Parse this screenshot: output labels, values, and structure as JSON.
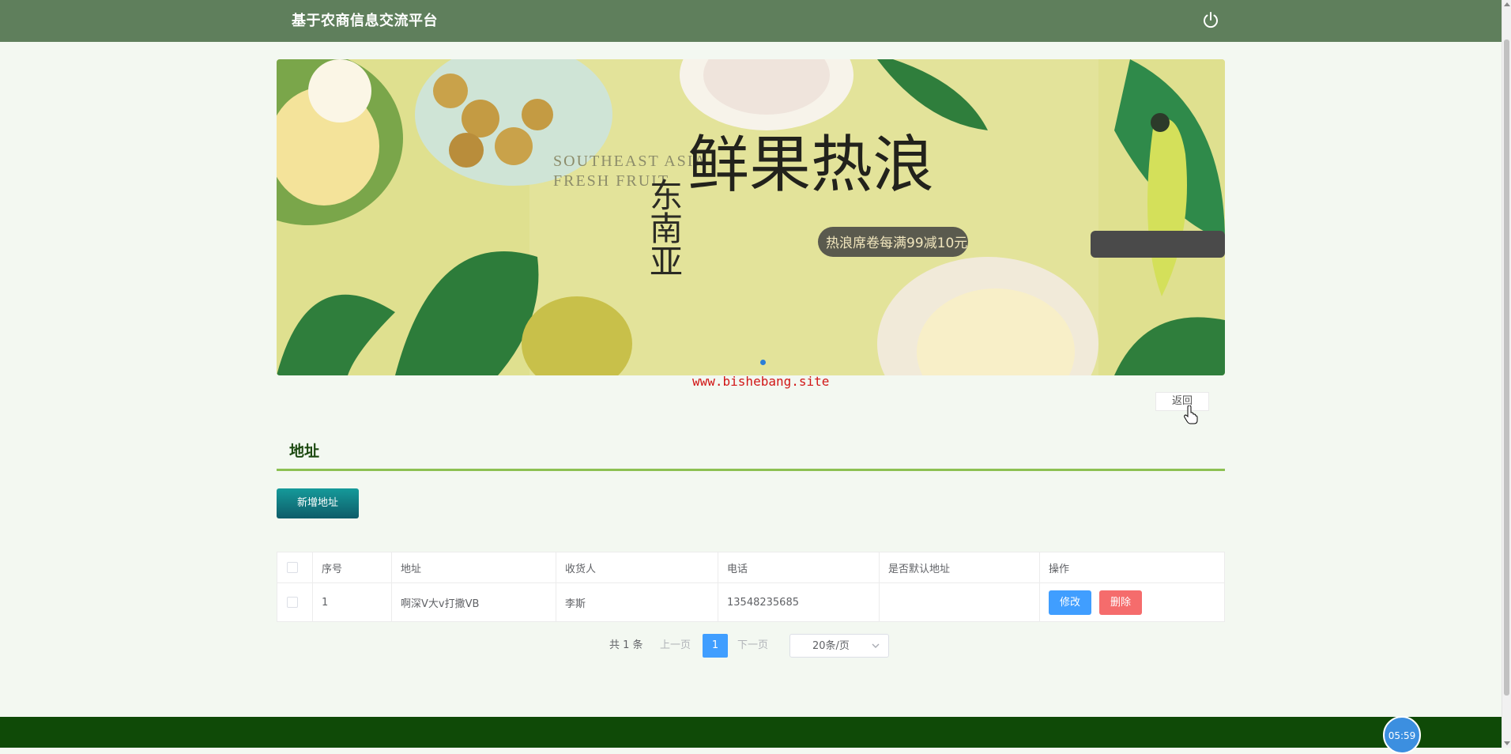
{
  "header": {
    "title": "基于农商信息交流平台",
    "icon": "power-icon"
  },
  "banner": {
    "subtitle": "SOUTHEAST ASIA",
    "fresh_fruit": "FRESH FRUIT",
    "region": "东南亚",
    "headline": "鲜果热浪",
    "promo": "热浪席卷每满99减10元"
  },
  "watermark": "www.bishebang.site",
  "back_label": "返回",
  "section": {
    "title": "地址"
  },
  "add_button": "新增地址",
  "table": {
    "headers": [
      "序号",
      "地址",
      "收货人",
      "电话",
      "是否默认地址",
      "操作"
    ],
    "rows": [
      {
        "index": "1",
        "address": "啊深V大v打撒VB",
        "receiver": "李斯",
        "phone": "13548235685",
        "is_default": "",
        "edit_label": "修改",
        "delete_label": "删除"
      }
    ]
  },
  "pagination": {
    "total_text": "共 1 条",
    "prev_label": "上一页",
    "current_page": "1",
    "next_label": "下一页",
    "page_size": "20条/页"
  },
  "timer": "05:59",
  "colors": {
    "header_bg": "#5f7f5c",
    "footer_bg": "#0f4a07",
    "accent_green": "#8cc152",
    "primary": "#409eff",
    "danger": "#f56c6c"
  }
}
